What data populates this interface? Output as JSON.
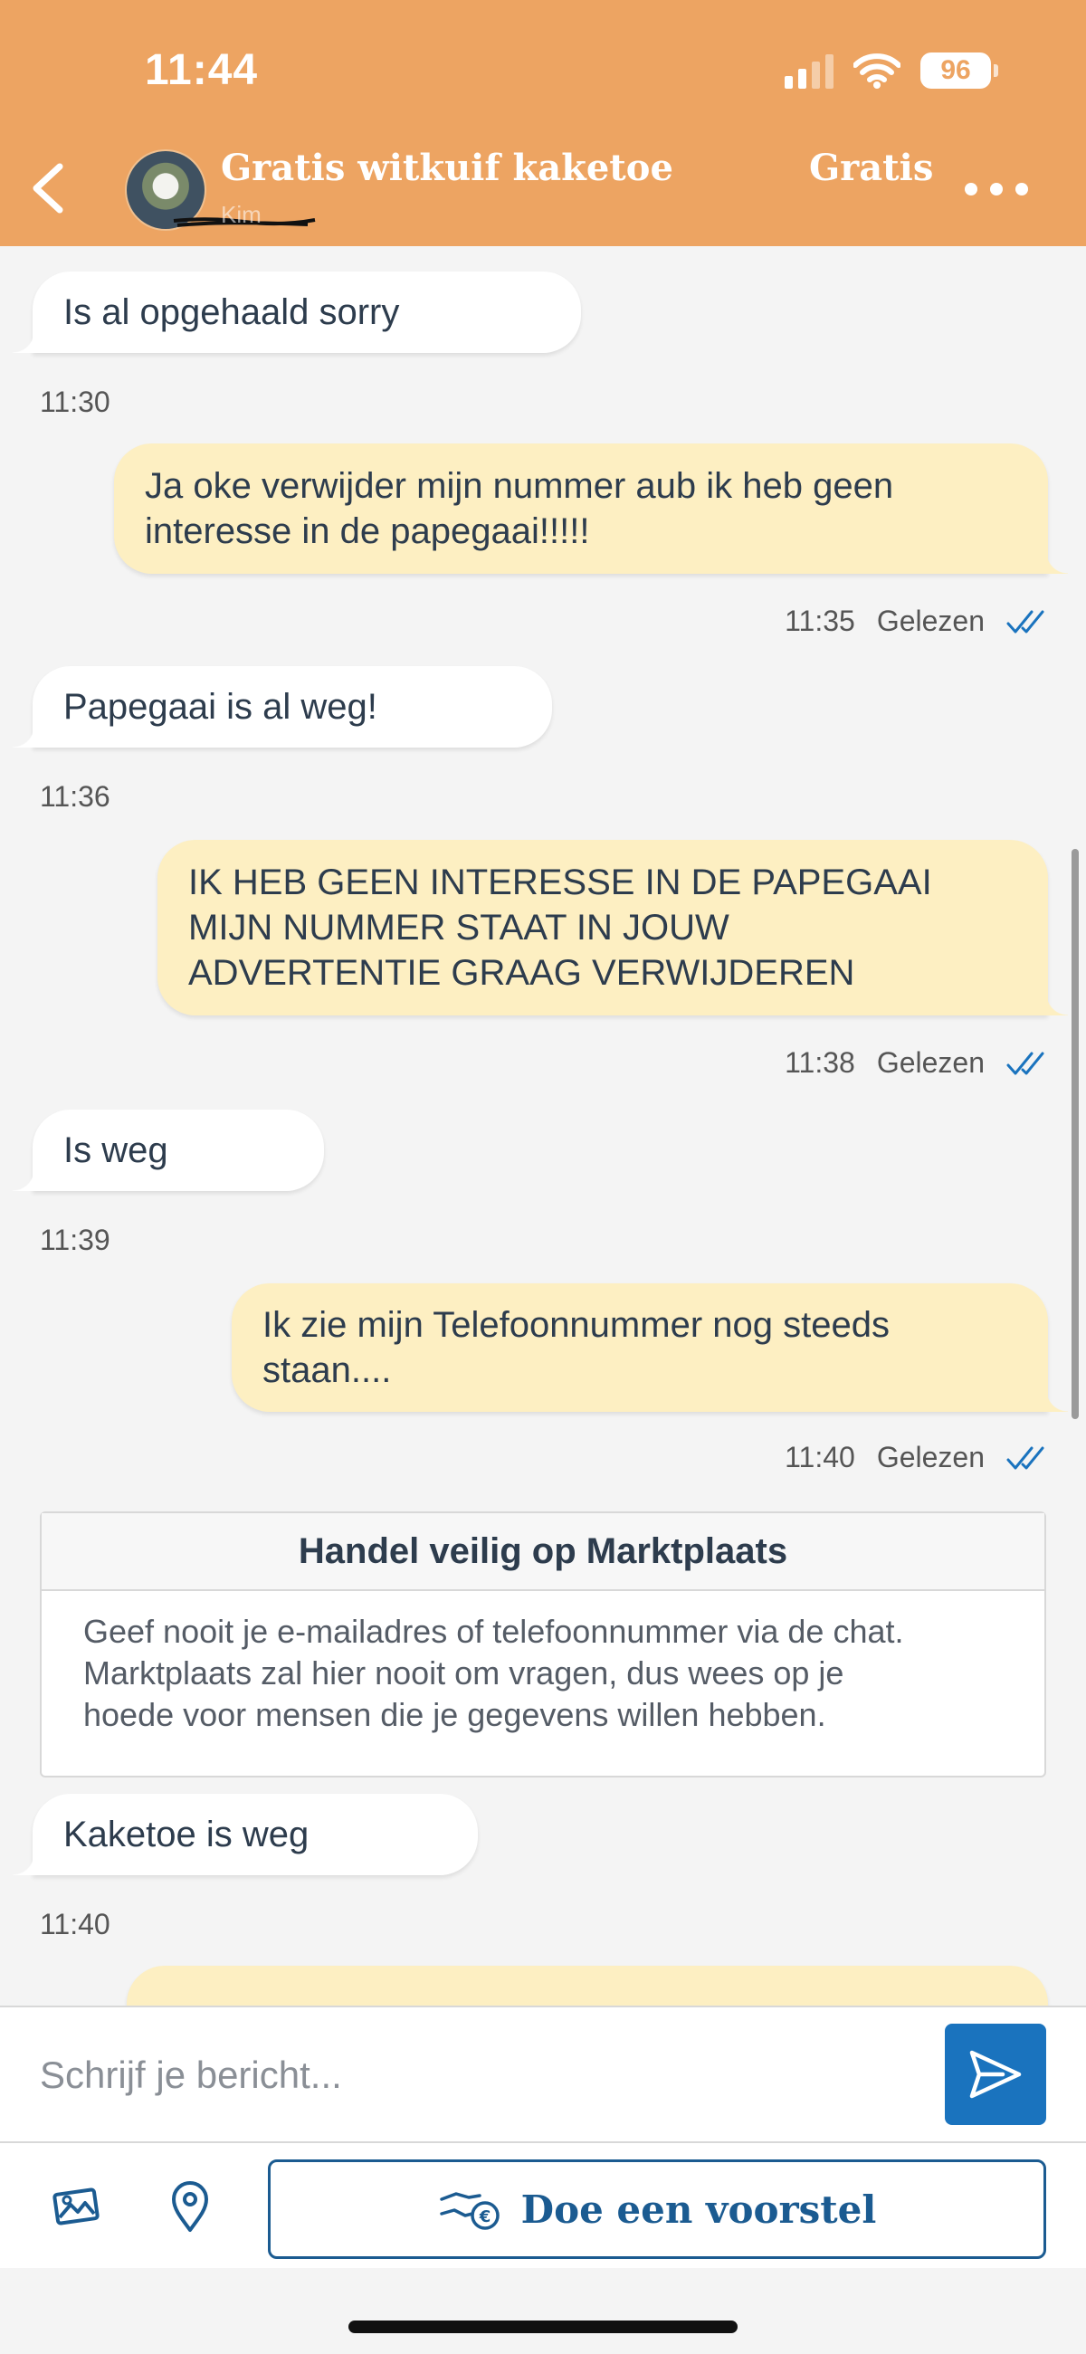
{
  "status_bar": {
    "time": "11:44",
    "battery": "96"
  },
  "header": {
    "title": "Gratis witkuif kaketoe",
    "subtitle": "Kim",
    "price": "Gratis",
    "colors": {
      "background": "#eda462"
    }
  },
  "messages": [
    {
      "direction": "in",
      "text": "Is al opgehaald sorry",
      "time": "11:30"
    },
    {
      "direction": "out",
      "text_lines": [
        "Ja oke verwijder mijn nummer aub ik heb geen",
        "interesse in de papegaai!!!!!"
      ],
      "time": "11:35",
      "status": "Gelezen"
    },
    {
      "direction": "in",
      "text": "Papegaai is al weg!",
      "time": "11:36"
    },
    {
      "direction": "out",
      "text_lines": [
        "IK HEB GEEN INTERESSE IN DE PAPEGAAI",
        "MIJN NUMMER STAAT IN JOUW",
        "ADVERTENTIE GRAAG VERWIJDEREN"
      ],
      "time": "11:38",
      "status": "Gelezen"
    },
    {
      "direction": "in",
      "text": "Is weg",
      "time": "11:39"
    },
    {
      "direction": "out",
      "text_lines": [
        "Ik zie mijn Telefoonnummer nog steeds",
        "staan...."
      ],
      "time": "11:40",
      "status": "Gelezen"
    },
    {
      "direction": "in",
      "text": "Kaketoe is weg",
      "time": "11:40"
    }
  ],
  "safety_notice": {
    "title": "Handel veilig op Marktplaats",
    "lines": [
      "Geef nooit je e-mailadres of telefoonnummer via de chat.",
      "Marktplaats zal hier nooit om vragen, dus wees op je",
      "hoede voor mensen die je gegevens willen hebben."
    ]
  },
  "composer": {
    "placeholder": "Schrijf je bericht..."
  },
  "toolbar": {
    "offer_label": "Doe een voorstel"
  },
  "icons": [
    "back-icon",
    "more-icon",
    "send-icon",
    "gallery-icon",
    "location-icon",
    "offer-hand-icon",
    "read-checks-icon"
  ],
  "colors": {
    "outgoing_bubble": "#fdefc2",
    "incoming_bubble": "#ffffff",
    "primary_blue": "#1a73be",
    "offer_blue": "#1b5b91"
  }
}
